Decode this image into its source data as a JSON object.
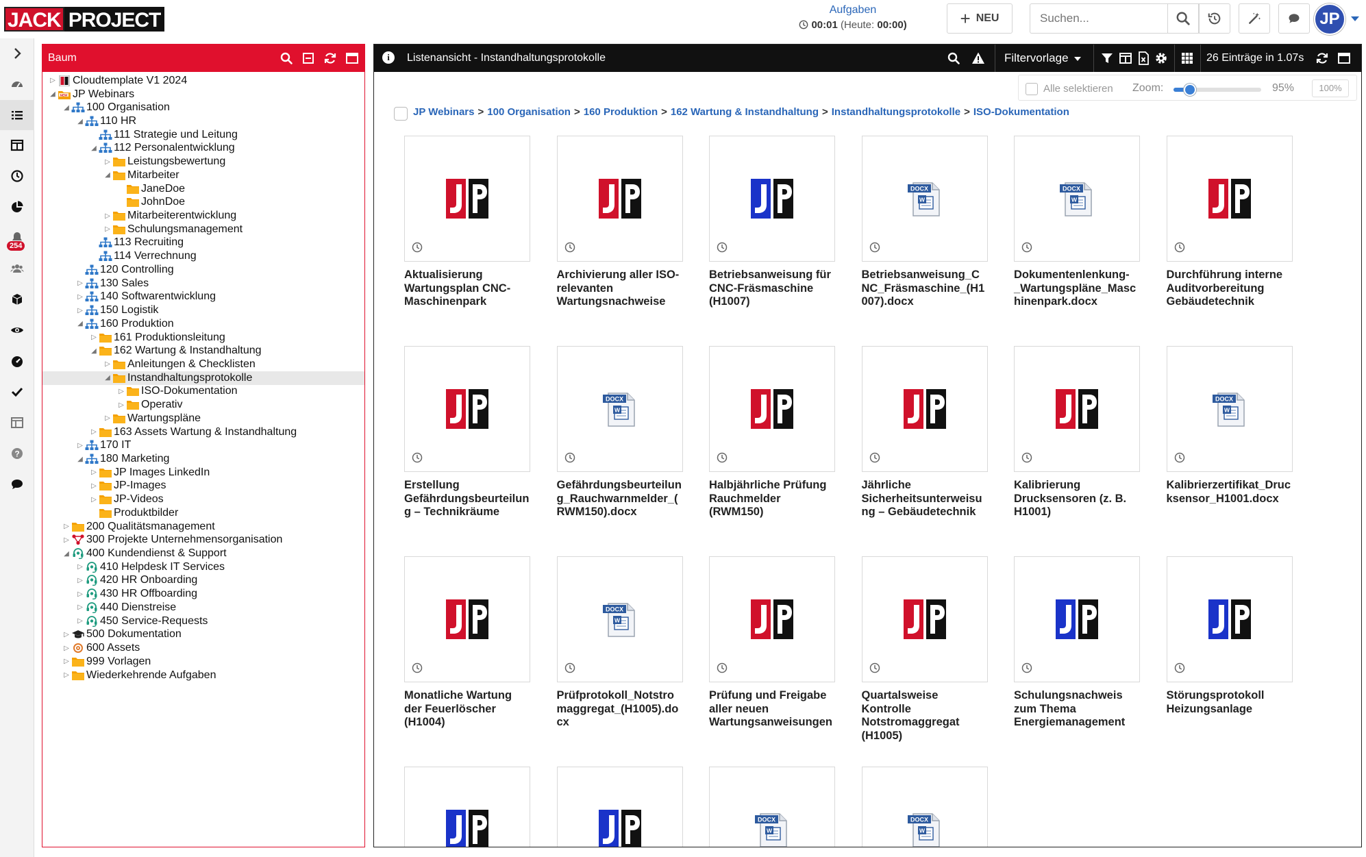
{
  "logo": {
    "part1": "JACK",
    "part2": "PROJECT"
  },
  "header": {
    "tasks_label": "Aufgaben",
    "timer": "00:01",
    "today_label": "(Heute:",
    "today_value": "00:00)",
    "new_label": "NEU",
    "search_placeholder": "Suchen...",
    "avatar_initials": "JP"
  },
  "rail": {
    "badge": "254"
  },
  "tree": {
    "title": "Baum",
    "nodes": [
      {
        "label": "Cloudtemplate V1 2024",
        "level": 0,
        "toggle": "closed",
        "icon": "jp-logo-icon"
      },
      {
        "label": "JP Webinars",
        "level": 0,
        "toggle": "open",
        "icon": "new-folder-icon"
      },
      {
        "label": "100 Organisation",
        "level": 1,
        "toggle": "open",
        "icon": "org-chart-icon"
      },
      {
        "label": "110 HR",
        "level": 2,
        "toggle": "open",
        "icon": "org-chart-icon"
      },
      {
        "label": "111 Strategie und Leitung",
        "level": 3,
        "toggle": "none",
        "icon": "org-chart-icon"
      },
      {
        "label": "112 Personalentwicklung",
        "level": 3,
        "toggle": "open",
        "icon": "org-chart-icon"
      },
      {
        "label": "Leistungsbewertung",
        "level": 4,
        "toggle": "closed",
        "icon": "folder-icon"
      },
      {
        "label": "Mitarbeiter",
        "level": 4,
        "toggle": "open",
        "icon": "folder-icon"
      },
      {
        "label": "JaneDoe",
        "level": 5,
        "toggle": "none",
        "icon": "folder-icon"
      },
      {
        "label": "JohnDoe",
        "level": 5,
        "toggle": "none",
        "icon": "folder-icon"
      },
      {
        "label": "Mitarbeiterentwicklung",
        "level": 4,
        "toggle": "closed",
        "icon": "folder-icon"
      },
      {
        "label": "Schulungsmanagement",
        "level": 4,
        "toggle": "closed",
        "icon": "folder-icon"
      },
      {
        "label": "113 Recruiting",
        "level": 3,
        "toggle": "none",
        "icon": "org-chart-icon"
      },
      {
        "label": "114 Verrechnung",
        "level": 3,
        "toggle": "none",
        "icon": "org-chart-icon"
      },
      {
        "label": "120 Controlling",
        "level": 2,
        "toggle": "none",
        "icon": "org-chart-icon"
      },
      {
        "label": "130 Sales",
        "level": 2,
        "toggle": "closed",
        "icon": "org-chart-icon"
      },
      {
        "label": "140 Softwarentwicklung",
        "level": 2,
        "toggle": "closed",
        "icon": "org-chart-icon"
      },
      {
        "label": "150 Logistik",
        "level": 2,
        "toggle": "closed",
        "icon": "org-chart-icon"
      },
      {
        "label": "160 Produktion",
        "level": 2,
        "toggle": "open",
        "icon": "org-chart-icon"
      },
      {
        "label": "161 Produktionsleitung",
        "level": 3,
        "toggle": "closed",
        "icon": "folder-icon"
      },
      {
        "label": "162 Wartung & Instandhaltung",
        "level": 3,
        "toggle": "open",
        "icon": "folder-icon"
      },
      {
        "label": "Anleitungen & Checklisten",
        "level": 4,
        "toggle": "closed",
        "icon": "folder-icon"
      },
      {
        "label": "Instandhaltungsprotokolle",
        "level": 4,
        "toggle": "open",
        "icon": "folder-icon",
        "selected": true
      },
      {
        "label": "ISO-Dokumentation",
        "level": 5,
        "toggle": "closed",
        "icon": "folder-icon"
      },
      {
        "label": "Operativ",
        "level": 5,
        "toggle": "closed",
        "icon": "folder-icon"
      },
      {
        "label": "Wartungspläne",
        "level": 4,
        "toggle": "closed",
        "icon": "folder-icon"
      },
      {
        "label": "163 Assets Wartung & Instandhaltung",
        "level": 3,
        "toggle": "closed",
        "icon": "folder-icon"
      },
      {
        "label": "170 IT",
        "level": 2,
        "toggle": "closed",
        "icon": "org-chart-icon"
      },
      {
        "label": "180 Marketing",
        "level": 2,
        "toggle": "open",
        "icon": "org-chart-icon"
      },
      {
        "label": "JP Images LinkedIn",
        "level": 3,
        "toggle": "closed",
        "icon": "folder-icon"
      },
      {
        "label": "JP-Images",
        "level": 3,
        "toggle": "closed",
        "icon": "folder-icon"
      },
      {
        "label": "JP-Videos",
        "level": 3,
        "toggle": "closed",
        "icon": "folder-icon"
      },
      {
        "label": "Produktbilder",
        "level": 3,
        "toggle": "none",
        "icon": "folder-icon"
      },
      {
        "label": "200 Qualitätsmanagement",
        "level": 1,
        "toggle": "closed",
        "icon": "folder-icon"
      },
      {
        "label": "300 Projekte Unternehmensorganisation",
        "level": 1,
        "toggle": "closed",
        "icon": "project-network-icon"
      },
      {
        "label": "400 Kundendienst & Support",
        "level": 1,
        "toggle": "open",
        "icon": "headset-icon"
      },
      {
        "label": "410 Helpdesk IT Services",
        "level": 2,
        "toggle": "closed",
        "icon": "headset-icon"
      },
      {
        "label": "420 HR Onboarding",
        "level": 2,
        "toggle": "closed",
        "icon": "headset-icon"
      },
      {
        "label": "430 HR Offboarding",
        "level": 2,
        "toggle": "closed",
        "icon": "headset-icon"
      },
      {
        "label": "440 Dienstreise",
        "level": 2,
        "toggle": "closed",
        "icon": "headset-icon"
      },
      {
        "label": "450 Service-Requests",
        "level": 2,
        "toggle": "closed",
        "icon": "headset-icon"
      },
      {
        "label": "500 Dokumentation",
        "level": 1,
        "toggle": "closed",
        "icon": "graduation-cap-icon"
      },
      {
        "label": "600 Assets",
        "level": 1,
        "toggle": "closed",
        "icon": "target-icon"
      },
      {
        "label": "999 Vorlagen",
        "level": 1,
        "toggle": "closed",
        "icon": "folder-icon"
      },
      {
        "label": "Wiederkehrende Aufgaben",
        "level": 1,
        "toggle": "closed",
        "icon": "folder-icon"
      }
    ]
  },
  "list": {
    "title": "Listenansicht - Instandhaltungsprotokolle",
    "filter_template": "Filtervorlage",
    "entries_info": "26 Einträge in 1.07s",
    "select_all": "Alle selektieren",
    "zoom_label": "Zoom:",
    "zoom_value": "95%",
    "zoom_fraction": 0.19,
    "zoom_reset": "100%",
    "breadcrumb": [
      "JP Webinars",
      "100 Organisation",
      "160 Produktion",
      "162 Wartung & Instandhaltung",
      "Instandhaltungsprotokolle",
      "ISO-Dokumentation"
    ],
    "items": [
      {
        "name": "Aktualisierung Wartungsplan CNC-Maschinenpark",
        "thumb": "jp-red"
      },
      {
        "name": "Archivierung aller ISO-relevanten Wartungsnachweise",
        "thumb": "jp-red"
      },
      {
        "name": "Betriebsanweisung für CNC-Fräsmaschine (H1007)",
        "thumb": "jp-blue"
      },
      {
        "name": "Betriebsanweisung_CNC_Fräsmaschine_(H1007).docx",
        "thumb": "docx"
      },
      {
        "name": "Dokumentenlenkung-_Wartungspläne_Maschinenpark.docx",
        "thumb": "docx"
      },
      {
        "name": "Durchführung interne Auditvorbereitung Gebäudetechnik",
        "thumb": "jp-red"
      },
      {
        "name": "Erstellung Gefährdungsbeurteilung – Technikräume",
        "thumb": "jp-red"
      },
      {
        "name": "Gefährdungsbeurteilung_Rauchwarnmelder_(RWM150).docx",
        "thumb": "docx"
      },
      {
        "name": "Halbjährliche Prüfung Rauchmelder (RWM150)",
        "thumb": "jp-red"
      },
      {
        "name": "Jährliche Sicherheitsunterweisung – Gebäudetechnik",
        "thumb": "jp-red"
      },
      {
        "name": "Kalibrierung Drucksensoren (z. B. H1001)",
        "thumb": "jp-red"
      },
      {
        "name": "Kalibrierzertifikat_Drucksensor_H1001.docx",
        "thumb": "docx"
      },
      {
        "name": "Monatliche Wartung der Feuerlöscher (H1004)",
        "thumb": "jp-red"
      },
      {
        "name": "Prüfprotokoll_Notstromaggregat_(H1005).docx",
        "thumb": "docx"
      },
      {
        "name": "Prüfung und Freigabe aller neuen Wartungsanweisungen",
        "thumb": "jp-red"
      },
      {
        "name": "Quartalsweise Kontrolle Notstromaggregat (H1005)",
        "thumb": "jp-red"
      },
      {
        "name": "Schulungsnachweis zum Thema Energiemanagement",
        "thumb": "jp-blue"
      },
      {
        "name": "Störungsprotokoll Heizungsanlage",
        "thumb": "jp-blue"
      },
      {
        "name": "",
        "thumb": "jp-blue"
      },
      {
        "name": "",
        "thumb": "jp-blue"
      },
      {
        "name": "",
        "thumb": "docx"
      },
      {
        "name": "",
        "thumb": "docx"
      }
    ]
  },
  "colors": {
    "brand_red": "#e0102d",
    "link_blue": "#2a66b8",
    "folder": "#f5a000",
    "org_blue": "#2f78c8"
  }
}
